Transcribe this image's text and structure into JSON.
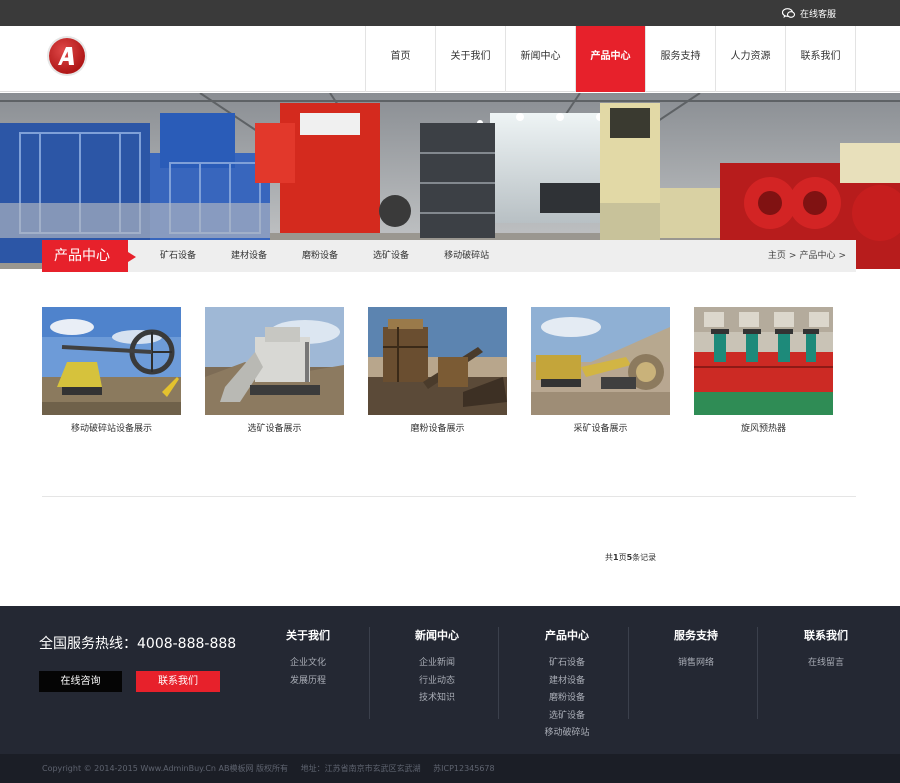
{
  "topbar": {
    "service_label": "在线客服"
  },
  "header": {
    "nav": [
      {
        "label": "首页",
        "active": false
      },
      {
        "label": "关于我们",
        "active": false
      },
      {
        "label": "新闻中心",
        "active": false
      },
      {
        "label": "产品中心",
        "active": true
      },
      {
        "label": "服务支持",
        "active": false
      },
      {
        "label": "人力资源",
        "active": false
      },
      {
        "label": "联系我们",
        "active": false
      }
    ]
  },
  "subnav": {
    "title": "产品中心",
    "categories": [
      "矿石设备",
      "建材设备",
      "磨粉设备",
      "选矿设备",
      "移动破碎站"
    ],
    "breadcrumb": [
      "主页",
      ">",
      "产品中心",
      ">"
    ]
  },
  "products": [
    {
      "caption": "移动破碎站设备展示",
      "icon": "bucket-wheel-excavator-photo"
    },
    {
      "caption": "选矿设备展示",
      "icon": "mining-excavator-photo"
    },
    {
      "caption": "磨粉设备展示",
      "icon": "screening-plant-photo"
    },
    {
      "caption": "采矿设备展示",
      "icon": "mobile-crusher-photo"
    },
    {
      "caption": "旋风预热器",
      "icon": "flotation-machine-photo"
    }
  ],
  "pagination": {
    "prefix": "共",
    "pages": "1",
    "mid": "页",
    "records": "5",
    "suffix": "条记录"
  },
  "footer": {
    "hotline": "全国服务热线：4008-888-888",
    "consult_button": "在线咨询",
    "contact_button": "联系我们",
    "columns": [
      {
        "title": "关于我们",
        "links": [
          "企业文化",
          "发展历程"
        ]
      },
      {
        "title": "新闻中心",
        "links": [
          "企业新闻",
          "行业动态",
          "技术知识"
        ]
      },
      {
        "title": "产品中心",
        "links": [
          "矿石设备",
          "建材设备",
          "磨粉设备",
          "选矿设备",
          "移动破碎站"
        ]
      },
      {
        "title": "服务支持",
        "links": [
          "销售网络"
        ]
      },
      {
        "title": "联系我们",
        "links": [
          "在线留言"
        ]
      }
    ],
    "copyright": "Copyright © 2014-2015 Www.AdminBuy.Cn AB模板网 版权所有",
    "address": "地址：江苏省南京市玄武区玄武湖",
    "icp": "苏ICP12345678"
  },
  "colors": {
    "accent": "#e7212b",
    "topbar": "#3a3a3a",
    "footer": "#242833"
  }
}
